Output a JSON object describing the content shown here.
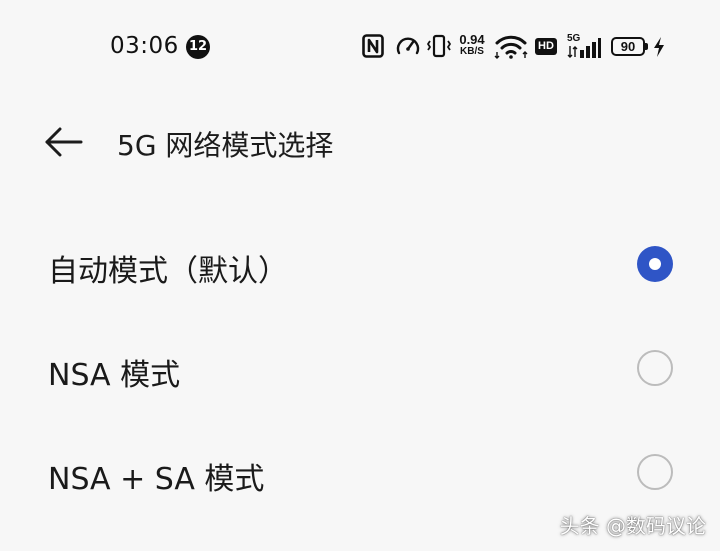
{
  "status_bar": {
    "time": "03:06",
    "notification_count": "12",
    "icons": [
      "nfc-icon",
      "speedometer-icon",
      "vibrate-icon",
      "wifi-icon",
      "hd-icon",
      "signal-icon",
      "battery-icon",
      "charging-icon"
    ],
    "net_speed_value": "0.94",
    "net_speed_unit": "KB/S",
    "hd_label": "HD",
    "network_type": "5G",
    "battery_level": "90"
  },
  "header": {
    "back_icon": "arrow-left-icon",
    "title": "5G 网络模式选择"
  },
  "options": [
    {
      "label": "自动模式（默认）",
      "selected": true
    },
    {
      "label": "NSA 模式",
      "selected": false
    },
    {
      "label": "NSA + SA 模式",
      "selected": false
    }
  ],
  "watermark": "头条 @数码议论",
  "colors": {
    "background": "#f7f7f7",
    "accent": "#2f55c6",
    "text": "#1a1a1a",
    "radio_border": "#bcbcbc"
  }
}
